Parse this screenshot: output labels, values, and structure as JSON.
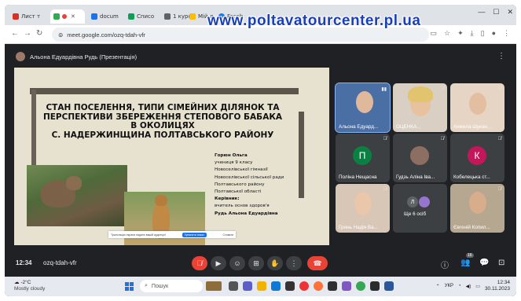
{
  "browser": {
    "tabs": [
      {
        "label": "Лист т",
        "color": "#d93025"
      },
      {
        "label": "",
        "color": "#34a853"
      },
      {
        "label": "docum",
        "color": "#1a73e8"
      },
      {
        "label": "Списо",
        "color": "#0f9d58"
      },
      {
        "label": "1 курс",
        "color": "#5f6368"
      },
      {
        "label": "Мій д",
        "color": "#fbbc04"
      },
      {
        "label": "Faceb",
        "color": "#1877f2"
      }
    ],
    "url": "meet.google.com/ozq-tdah-vfr",
    "watermark": "www.poltavatourcenter.pl.ua"
  },
  "meet": {
    "presenter_label": "Альона Едуардівна Рудь (Презентація)",
    "slide": {
      "title_lines": [
        "СТАН ПОСЕЛЕННЯ, ТИПИ СІМЕЙНИХ ДІЛЯНОК ТА",
        "ПЕРСПЕКТИВИ ЗБЕРЕЖЕННЯ СТЕПОВОГО БАБАКА",
        "В ОКОЛИЦЯХ",
        "С. НАДЕРЖИНЩИНА ПОЛТАВСЬКОГО РАЙОНУ"
      ],
      "author_name": "Горюн Ольга",
      "author_lines": [
        "учениця 9 класу",
        "Новоселівської гімназії",
        "Новоселівської сільської ради",
        "Полтавського району",
        "Полтавської області"
      ],
      "supervisor_label": "Керівник:",
      "supervisor_role": "вчитель основ здоров'я",
      "supervisor_name": "Рудь Альона Едуардівна",
      "share_text": "Трансляцію екрана надано вашій аудиторії",
      "share_button": "Зупинити показ",
      "share_hide": "Сховати"
    },
    "participants": [
      {
        "name": "Альона Едуард...",
        "type": "video",
        "color": "#4a6fa5"
      },
      {
        "name": "ОЦЕНКА...",
        "type": "video",
        "color": "#c9b8a8"
      },
      {
        "name": "Анжела Шукан...",
        "type": "video",
        "color": "#d9c2b0"
      },
      {
        "name": "Поліна Нещасна",
        "type": "initial",
        "initial": "П",
        "color": "#0b8043"
      },
      {
        "name": "Гудзь Аліна Іва...",
        "type": "avatar",
        "color": "#8d6e63"
      },
      {
        "name": "Кобелецька ст...",
        "type": "initial",
        "initial": "К",
        "color": "#c2185b"
      },
      {
        "name": "Гринь Надія Ва...",
        "type": "video",
        "color": "#e0cfc0"
      },
      {
        "name": "Ще 6 осіб",
        "type": "more",
        "color": "#3c4043"
      },
      {
        "name": "Євгеній Копил...",
        "type": "video",
        "color": "#b9a58d"
      }
    ],
    "more_avatars": [
      "Л",
      ""
    ],
    "clock": "12:34",
    "meeting_code": "ozq-tdah-vfr",
    "participants_count": "16"
  },
  "taskbar": {
    "temp": "-2°C",
    "weather": "Mostly cloudy",
    "search_placeholder": "Пошук",
    "lang": "УКР",
    "time": "12:34",
    "date": "30.11.2023"
  },
  "colors": {
    "accent": "#1a73e8",
    "end_call": "#ea4335",
    "meet_bg": "#202124"
  }
}
